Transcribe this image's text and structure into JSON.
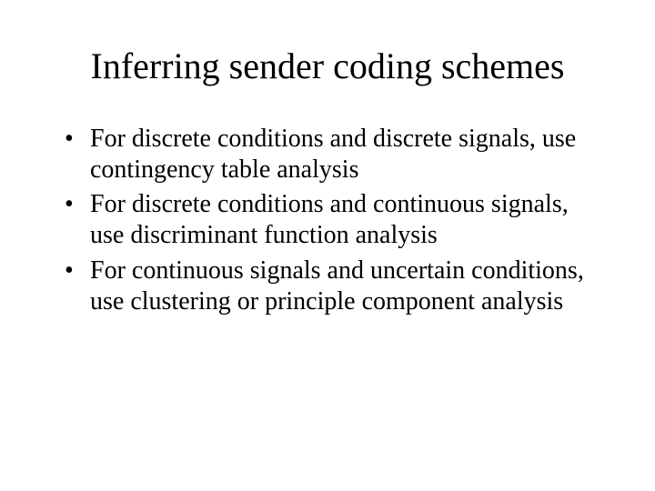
{
  "slide": {
    "title": "Inferring sender coding schemes",
    "bullets": [
      "For discrete conditions and discrete signals, use contingency table analysis",
      "For discrete conditions and continuous signals, use discriminant function analysis",
      "For continuous signals and uncertain conditions, use clustering or principle component analysis"
    ]
  }
}
